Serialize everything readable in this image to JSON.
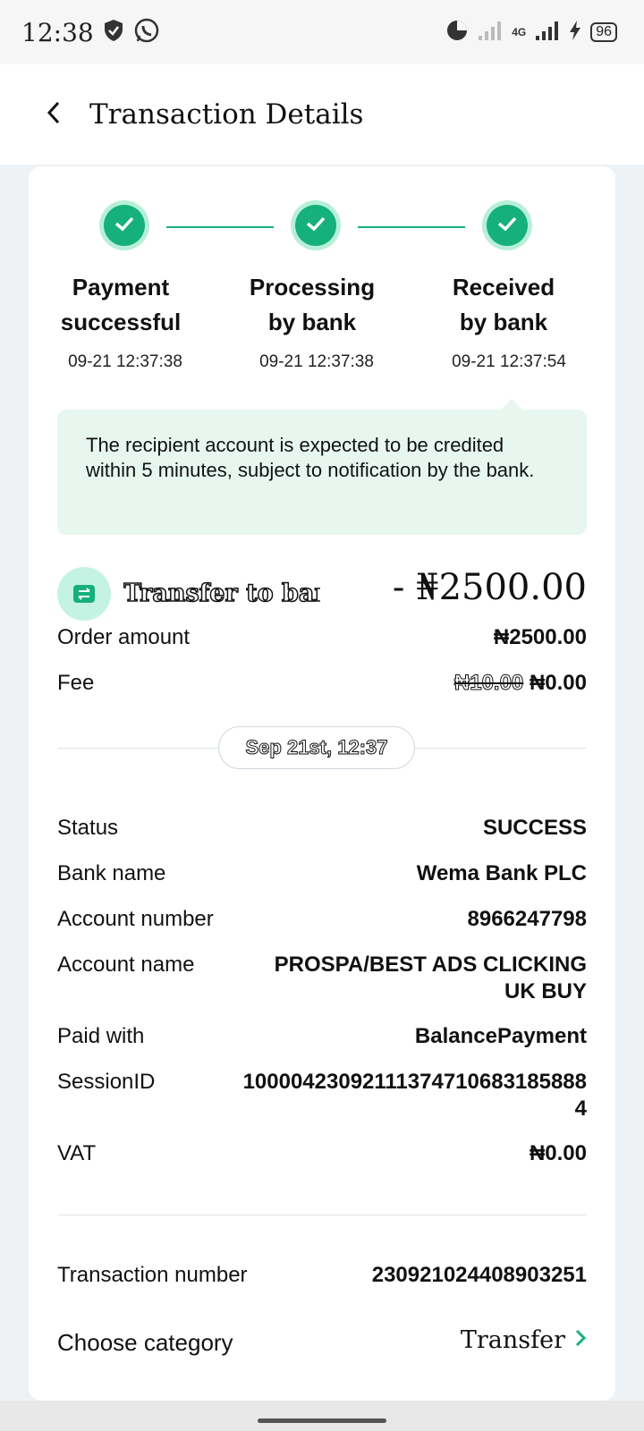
{
  "status_bar": {
    "time": "12:38",
    "network": "4G",
    "battery": "96"
  },
  "header": {
    "title": "Transaction Details"
  },
  "steps": [
    {
      "label_line1": "Payment",
      "label_line2": "successful",
      "time": "09-21 12:37:38"
    },
    {
      "label_line1": "Processing",
      "label_line2": "by bank",
      "time": "09-21 12:37:38"
    },
    {
      "label_line1": "Received",
      "label_line2": "by bank",
      "time": "09-21 12:37:54"
    }
  ],
  "notice": "The recipient account is expected to be credited within 5 minutes, subject to notification by the bank.",
  "transfer": {
    "label": "Transfer to bank",
    "amount": "- ₦2500.00"
  },
  "summary": {
    "order_amount_label": "Order amount",
    "order_amount_value": "₦2500.00",
    "fee_label": "Fee",
    "fee_original": "₦10.00",
    "fee_value": "₦0.00"
  },
  "date_pill": "Sep 21st, 12:37",
  "details": [
    {
      "label": "Status",
      "value": "SUCCESS"
    },
    {
      "label": "Bank name",
      "value": "Wema Bank PLC"
    },
    {
      "label": "Account number",
      "value": "8966247798"
    },
    {
      "label": "Account name",
      "value": "PROSPA/BEST ADS CLICKING UK BUY"
    },
    {
      "label": "Paid with",
      "value": "BalancePayment"
    },
    {
      "label": "SessionID",
      "value": "100004230921113747106831858884"
    },
    {
      "label": "VAT",
      "value": "₦0.00"
    }
  ],
  "transaction_number": {
    "label": "Transaction number",
    "value": "230921024408903251"
  },
  "category": {
    "label": "Choose category",
    "value": "Transfer"
  },
  "colors": {
    "accent": "#16b07c",
    "accent_light": "#b8efd9",
    "notice_bg": "#e7f7f0",
    "page_bg": "#eef2f5"
  }
}
